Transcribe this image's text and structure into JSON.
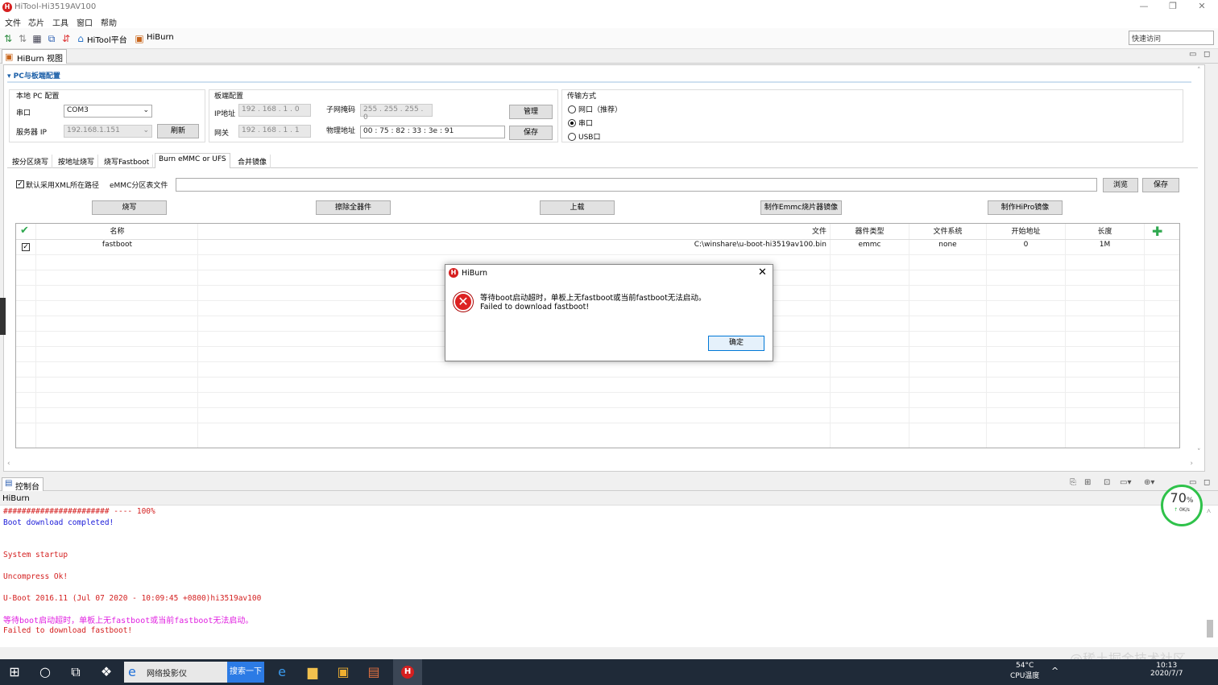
{
  "window": {
    "title": "HiTool-Hi3519AV100"
  },
  "menu": [
    "文件",
    "芯片",
    "工具",
    "窗口",
    "帮助"
  ],
  "toolbar": {
    "hitool_label": "HiTool平台",
    "hiburn_label": "HiBurn",
    "quick_access": "快速访问"
  },
  "view_tab": "HiBurn 视图",
  "section_title": "PC与板端配置",
  "local_pc": {
    "title": "本地 PC 配置",
    "serial_label": "串口",
    "serial_value": "COM3",
    "server_ip_label": "服务器 IP",
    "server_ip_value": "192.168.1.151",
    "refresh_label": "刷新"
  },
  "board": {
    "title": "板端配置",
    "ip_label": "IP地址",
    "ip_value": "192 . 168 .  1  .  0",
    "mask_label": "子网掩码",
    "mask_value": "255 . 255 . 255 .  0",
    "gateway_label": "网关",
    "gateway_value": "192 . 168 .  1  .  1",
    "mac_label": "物理地址",
    "mac_value": "00  :  75  :  82  :  33  :  3e  :  91",
    "manage_label": "管理",
    "save_label": "保存"
  },
  "transfer": {
    "title": "传输方式",
    "options": [
      "网口（推荐）",
      "串口",
      "USB口"
    ],
    "selected": 1
  },
  "tabs": [
    "按分区烧写",
    "按地址烧写",
    "烧写Fastboot",
    "Burn eMMC or UFS",
    "合并镜像"
  ],
  "active_tab": 3,
  "xml": {
    "checkbox_label": "默认采用XML所在路径",
    "table_label": "eMMC分区表文件",
    "browse_label": "浏览",
    "save_label": "保存"
  },
  "actions": [
    "烧写",
    "擦除全器件",
    "上载",
    "制作Emmc烧片器镜像",
    "制作HiPro镜像"
  ],
  "table": {
    "headers": [
      "名称",
      "文件",
      "器件类型",
      "文件系统",
      "开始地址",
      "长度"
    ],
    "rows": [
      {
        "name": "fastboot",
        "file": "C:\\winshare\\u-boot-hi3519av100.bin",
        "device": "emmc",
        "fs": "none",
        "start": "0",
        "length": "1M"
      }
    ]
  },
  "console": {
    "tab": "控制台",
    "name": "HiBurn",
    "lines": [
      {
        "text": "####################### ---- 100%",
        "color": "red"
      },
      {
        "text": "Boot download completed!",
        "color": "blue"
      },
      {
        "text": "",
        "color": "red"
      },
      {
        "text": "",
        "color": "red"
      },
      {
        "text": "System startup",
        "color": "red"
      },
      {
        "text": "",
        "color": "red"
      },
      {
        "text": "Uncompress Ok!",
        "color": "red"
      },
      {
        "text": "",
        "color": "red"
      },
      {
        "text": "U-Boot 2016.11 (Jul 07 2020 - 10:09:45 +0800)hi3519av100",
        "color": "red"
      },
      {
        "text": "",
        "color": "red"
      },
      {
        "text": "等待boot启动超时，单板上无fastboot或当前fastboot无法启动。",
        "color": "mag"
      },
      {
        "text": "Failed to download fastboot!",
        "color": "red"
      }
    ]
  },
  "dialog": {
    "title": "HiBurn",
    "message1": "等待boot启动超时，单板上无fastboot或当前fastboot无法启动。",
    "message2": "Failed to download fastboot!",
    "ok_label": "确定"
  },
  "gauge": {
    "percent": "70",
    "unit": "%",
    "speed": "0K/s"
  },
  "taskbar": {
    "app_label": "网络投影仪",
    "search_label": "搜索一下",
    "temp": "54°C",
    "temp_label": "CPU温度",
    "time": "10:13",
    "date": "2020/7/7"
  },
  "watermark": "@稀土掘金技术社区"
}
